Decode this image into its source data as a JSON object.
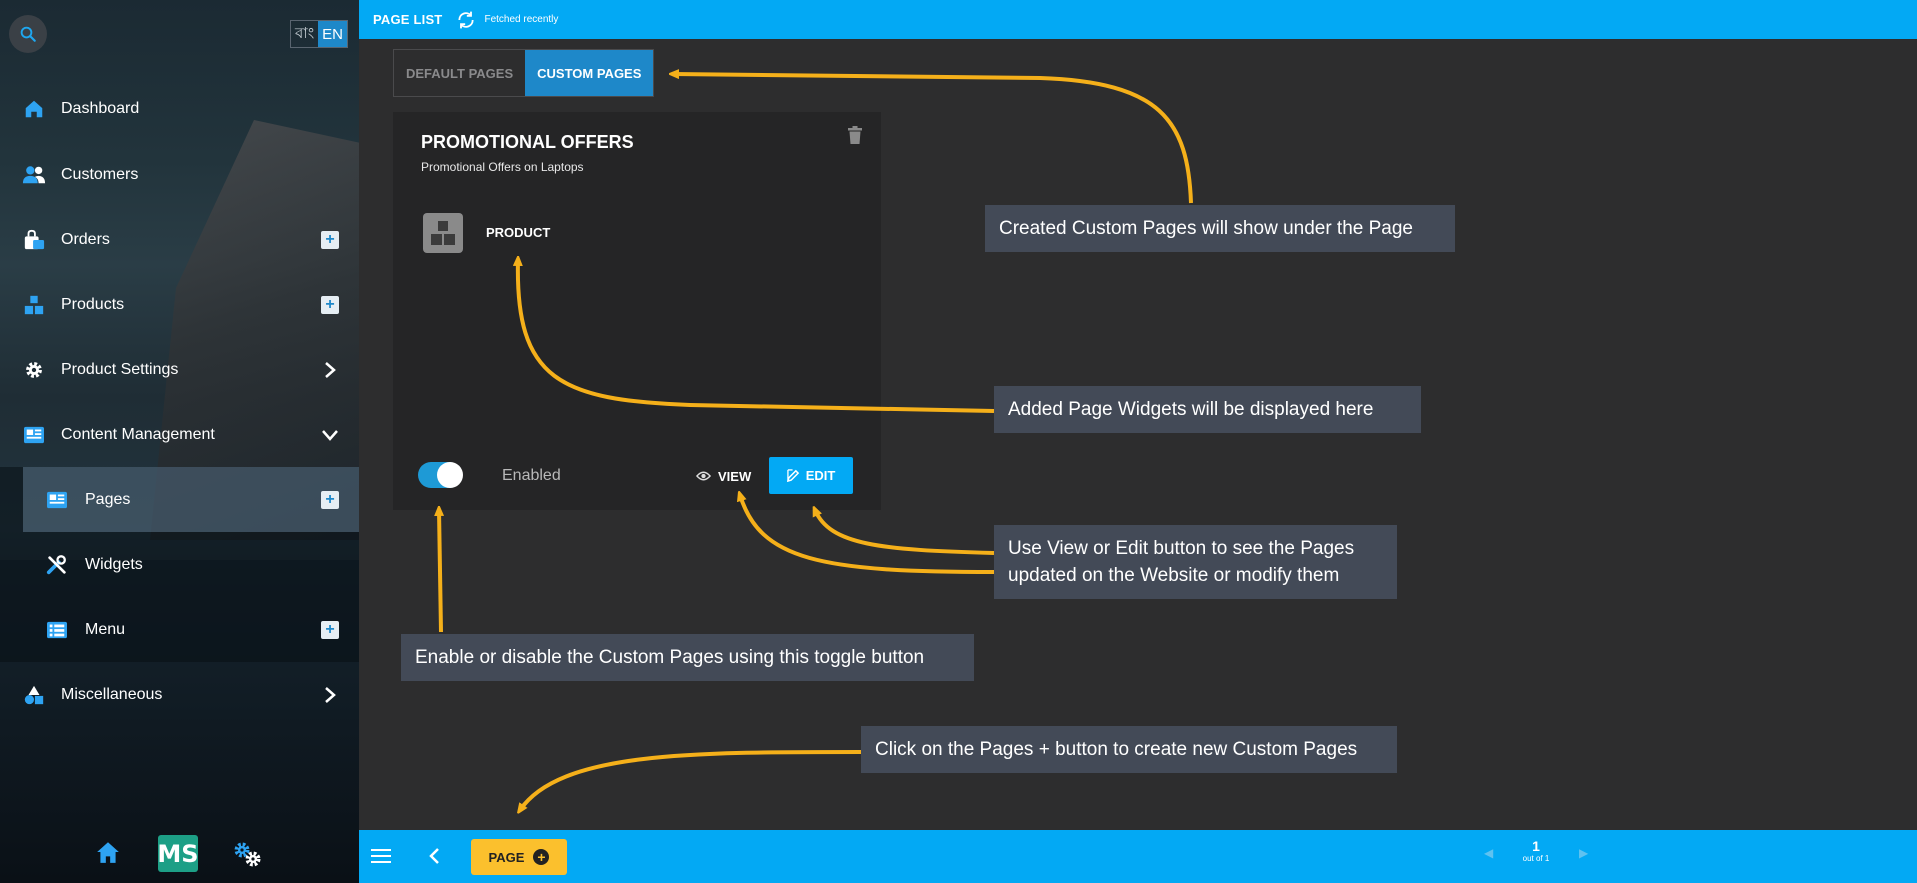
{
  "sidebar": {
    "lang": {
      "bn": "বাং",
      "en": "EN"
    },
    "items": [
      {
        "label": "Dashboard"
      },
      {
        "label": "Customers"
      },
      {
        "label": "Orders"
      },
      {
        "label": "Products"
      },
      {
        "label": "Product Settings"
      },
      {
        "label": "Content Management"
      },
      {
        "label": "Pages"
      },
      {
        "label": "Widgets"
      },
      {
        "label": "Menu"
      },
      {
        "label": "Miscellaneous"
      }
    ],
    "bottom_logo": "MS"
  },
  "topbar": {
    "title": "PAGE LIST",
    "status": "Fetched recently"
  },
  "tabs": [
    {
      "label": "DEFAULT PAGES",
      "active": false
    },
    {
      "label": "CUSTOM PAGES",
      "active": true
    }
  ],
  "card": {
    "title": "PROMOTIONAL OFFERS",
    "subtitle": "Promotional Offers on Laptops",
    "widget_label": "PRODUCT",
    "toggle_label": "Enabled",
    "toggle_on": true,
    "view_label": "VIEW",
    "edit_label": "EDIT"
  },
  "callouts": {
    "custom_pages": "Created Custom Pages will show under the Page",
    "widgets": "Added Page Widgets will be displayed here",
    "view_edit_line1": "Use View or Edit button to see the Pages",
    "view_edit_line2": "updated on the Website or modify them",
    "toggle": "Enable or disable the Custom Pages using this toggle button",
    "create": "Click on the Pages + button to create new Custom Pages"
  },
  "bottombar": {
    "page_button": "PAGE",
    "page_number": "1",
    "page_total": "out of 1"
  },
  "colors": {
    "accent": "#03a9f4",
    "tab_active": "#1e88c9",
    "arrow": "#f5b01a",
    "callout": "#434a57",
    "page_button": "#fbc02d"
  }
}
